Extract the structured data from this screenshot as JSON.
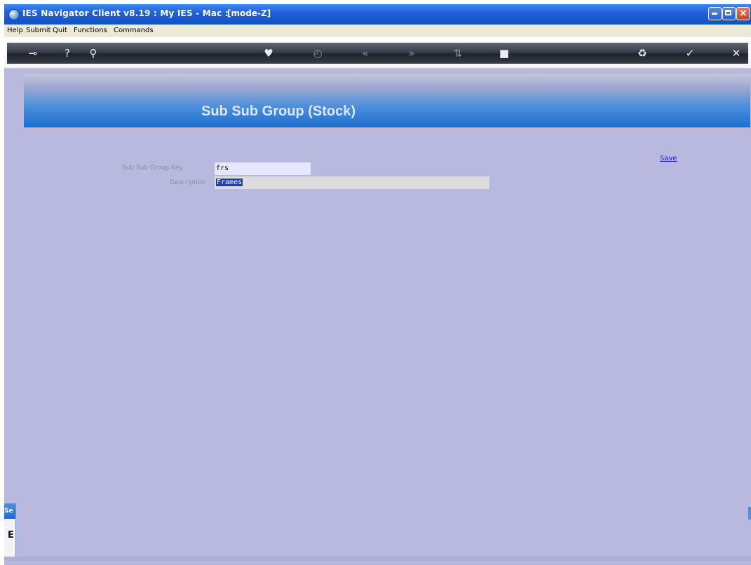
{
  "window": {
    "title": "IES Navigator Client v8.19 : My IES - Mac :",
    "mode": "[mode-Z]",
    "controls": [
      "minimize",
      "maximize",
      "close"
    ]
  },
  "menu": [
    "Help",
    "Submit",
    "Quit",
    "Functions",
    "Commands"
  ],
  "toolbar": {
    "icons": [
      {
        "name": "key-icon",
        "glyph": "⊸"
      },
      {
        "name": "help-icon",
        "glyph": "?"
      },
      {
        "name": "search-icon",
        "glyph": "⚲"
      },
      {
        "name": "heart-icon",
        "glyph": "♥"
      },
      {
        "name": "clock-icon",
        "glyph": "◴"
      },
      {
        "name": "back-icon",
        "glyph": "«"
      },
      {
        "name": "forward-icon",
        "glyph": "»"
      },
      {
        "name": "sort-icon",
        "glyph": "⇅"
      },
      {
        "name": "stop-icon",
        "glyph": "■"
      },
      {
        "name": "recycle-icon",
        "glyph": "♻"
      },
      {
        "name": "check-icon",
        "glyph": "✓"
      },
      {
        "name": "close-icon",
        "glyph": "✕"
      }
    ]
  },
  "banner": {
    "title": "Sub Sub Group (Stock)"
  },
  "form": {
    "key_label": "Sub Sub Group Key",
    "key_value": "frs",
    "description_label": "Description",
    "description_value": "Frames"
  },
  "actions": {
    "save": "Save"
  },
  "side_panel": {
    "header": "Se",
    "body": "E"
  }
}
